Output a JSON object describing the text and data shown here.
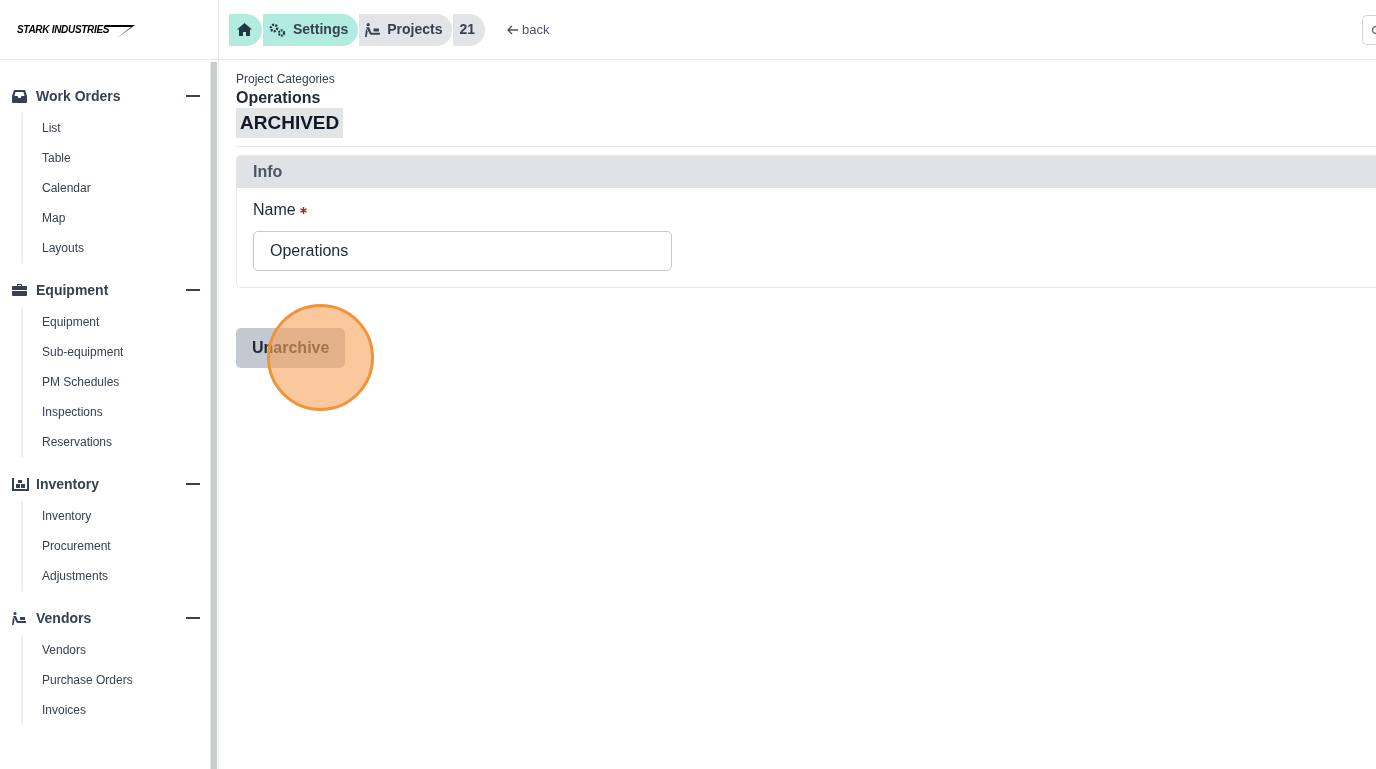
{
  "logo": {
    "text": "STARK INDUSTRIES"
  },
  "breadcrumbs": [
    {
      "kind": "home"
    },
    {
      "kind": "settings",
      "label": "Settings"
    },
    {
      "kind": "projects",
      "label": "Projects"
    },
    {
      "kind": "count",
      "label": "21"
    }
  ],
  "back_link": "back",
  "sidebar": {
    "sections": [
      {
        "title": "Work Orders",
        "expanded": true,
        "items": [
          "List",
          "Table",
          "Calendar",
          "Map",
          "Layouts"
        ]
      },
      {
        "title": "Equipment",
        "expanded": true,
        "items": [
          "Equipment",
          "Sub-equipment",
          "PM Schedules",
          "Inspections",
          "Reservations"
        ]
      },
      {
        "title": "Inventory",
        "expanded": true,
        "items": [
          "Inventory",
          "Procurement",
          "Adjustments"
        ]
      },
      {
        "title": "Vendors",
        "expanded": true,
        "items": [
          "Vendors",
          "Purchase Orders",
          "Invoices"
        ]
      }
    ]
  },
  "page": {
    "parent": "Project Categories",
    "title": "Operations",
    "status": "ARCHIVED"
  },
  "info_panel": {
    "title": "Info",
    "fields": [
      {
        "label": "Name",
        "required": true,
        "value": "Operations"
      }
    ]
  },
  "action_button": {
    "label": "Unarchive",
    "click_marker": true
  }
}
